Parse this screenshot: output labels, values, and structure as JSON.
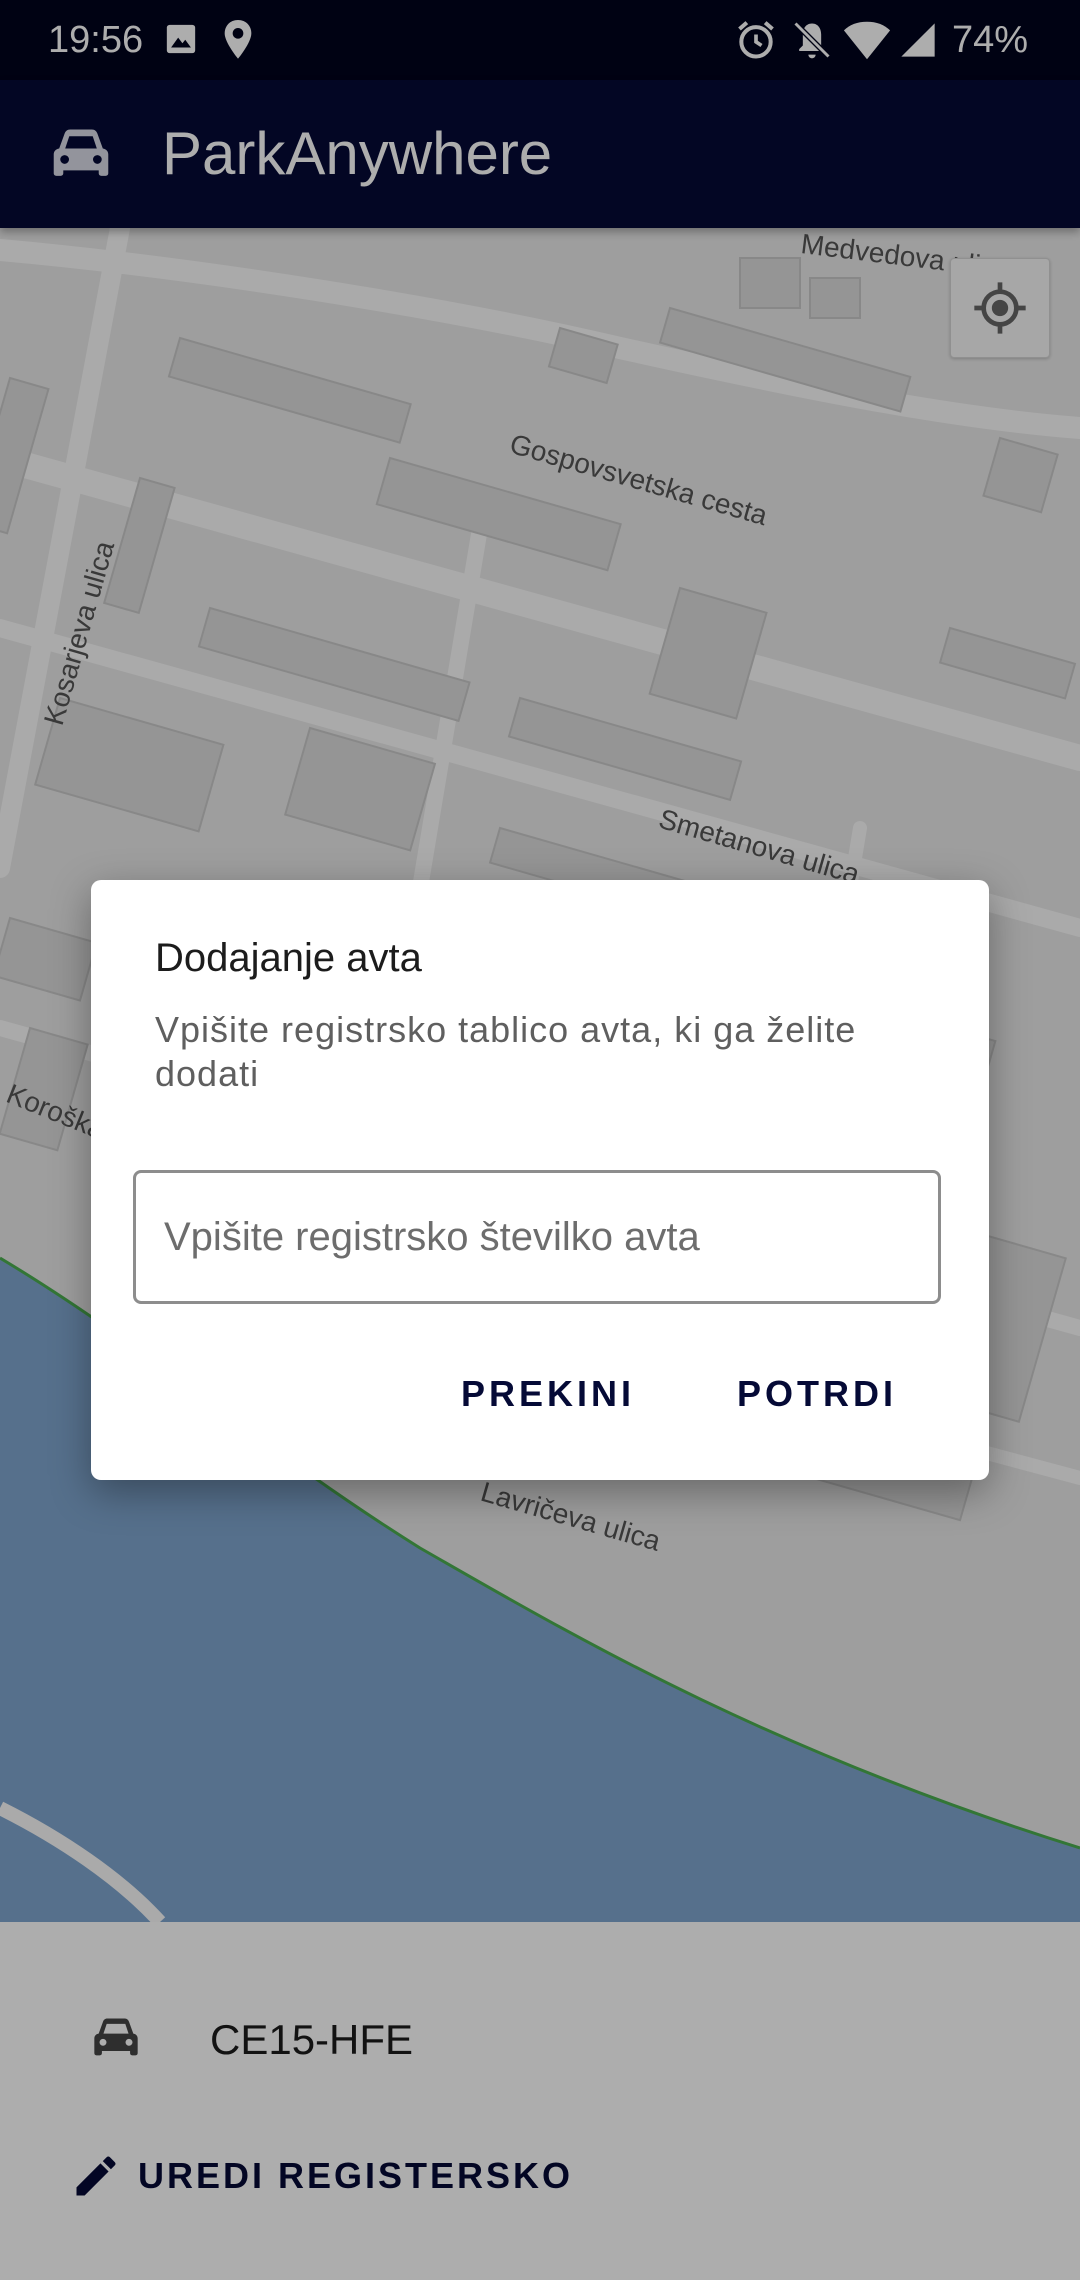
{
  "status_bar": {
    "time": "19:56",
    "battery": "74%",
    "icons": [
      "gallery-icon",
      "location-icon",
      "alarm-icon",
      "bell-off-icon",
      "wifi-icon",
      "signal-icon"
    ]
  },
  "app_bar": {
    "title": "ParkAnywhere",
    "icon": "car-icon",
    "background": "#050a36"
  },
  "map": {
    "street_labels": [
      "Medvedova ulica",
      "Gospovsvetska cesta",
      "Kosarjeva ulica",
      "Smetanova ulica",
      "Koroška c",
      "Lavričeva ulica"
    ],
    "water_color": "#7fa6cf",
    "locate_button_icon": "my-location-icon"
  },
  "bottom_panel": {
    "plate": "CE15-HFE",
    "edit_label": "UREDI REGISTERSKO",
    "edit_icon": "pencil-icon"
  },
  "dialog": {
    "title": "Dodajanje avta",
    "message": "Vpišite registrsko tablico avta, ki ga želite dodati",
    "input_placeholder": "Vpišite registrsko številko avta",
    "input_value": "",
    "cancel_label": "PREKINI",
    "confirm_label": "POTRDI"
  }
}
